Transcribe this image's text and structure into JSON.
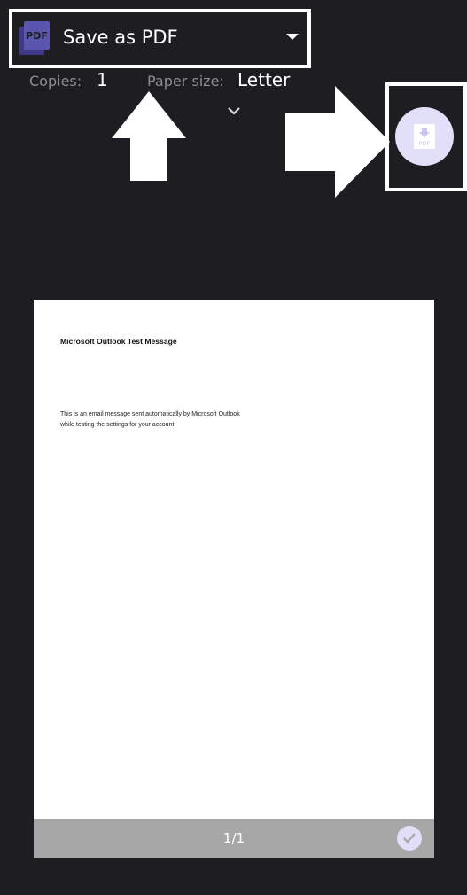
{
  "printer": {
    "name": "Save as PDF",
    "icon": "pdf-printer-icon"
  },
  "settings": {
    "copies_label": "Copies:",
    "copies_value": "1",
    "paper_size_label": "Paper size:",
    "paper_size_value": "Letter"
  },
  "download_button": {
    "icon": "download-pdf-icon",
    "icon_text": "PDF"
  },
  "preview": {
    "title": "Microsoft Outlook Test Message",
    "body": "This is an email message sent automatically by Microsoft Outlook while testing the settings for your account.",
    "page_count": "1/1"
  },
  "colors": {
    "background": "#1e1d22",
    "accent": "#e2e0f9",
    "icon_primary": "#4e4aa0",
    "footer": "#a7a7a7"
  }
}
